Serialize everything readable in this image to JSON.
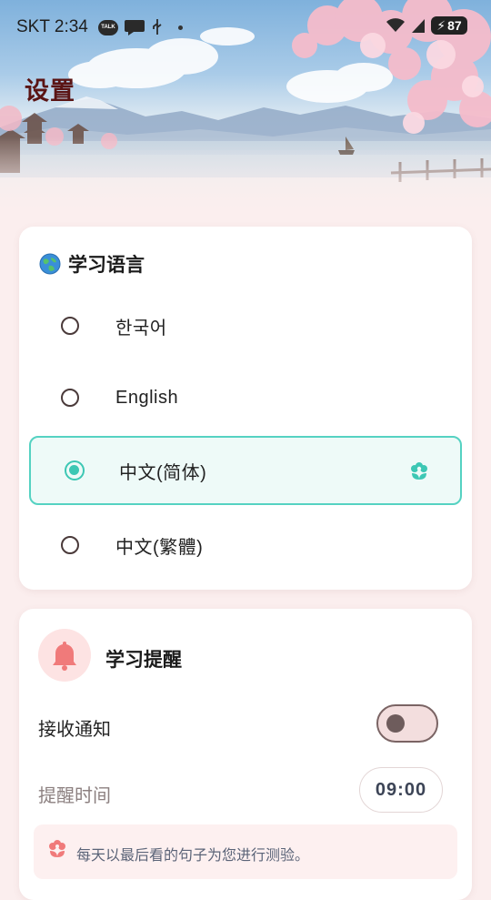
{
  "status_bar": {
    "carrier": "SKT",
    "time": "2:34",
    "talk_badge": "TALK",
    "battery": "87"
  },
  "header": {
    "title": "设置"
  },
  "language_card": {
    "title": "学习语言",
    "options": [
      {
        "label": "한국어",
        "selected": false
      },
      {
        "label": "English",
        "selected": false
      },
      {
        "label": "中文(简体)",
        "selected": true
      },
      {
        "label": "中文(繁體)",
        "selected": false
      }
    ]
  },
  "reminder_card": {
    "title": "学习提醒",
    "notification_label": "接收通知",
    "notification_enabled": false,
    "time_label": "提醒时间",
    "time_value": "09:00",
    "note": "每天以最后看的句子为您进行测验。"
  },
  "colors": {
    "accent": "#3cc7b4",
    "title": "#5a1414",
    "background": "#fbeeee",
    "bell": "#f07a7a"
  },
  "icons": {
    "globe": "globe-icon",
    "flower": "flower-icon",
    "bell": "bell-icon",
    "wifi": "wifi-icon",
    "signal": "signal-icon",
    "usb": "usb-icon"
  }
}
